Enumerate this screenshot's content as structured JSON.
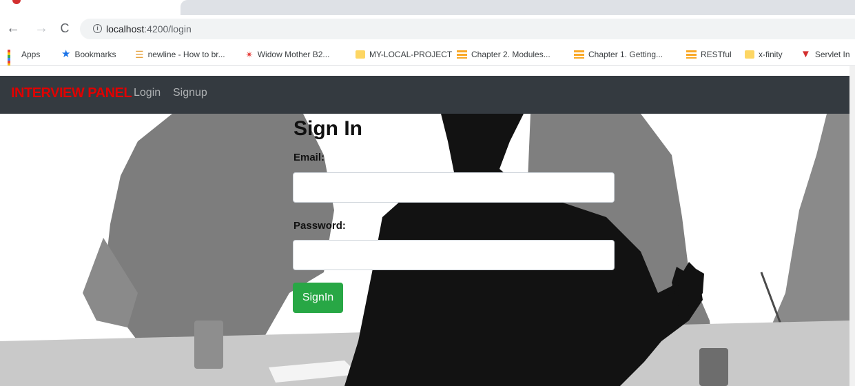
{
  "browser": {
    "url_host": "localhost",
    "url_rest": ":4200/login",
    "bookmarks": [
      {
        "label": "Apps",
        "icon": "apps-grid-icon"
      },
      {
        "label": "Bookmarks",
        "icon": "star-icon"
      },
      {
        "label": "newline - How to br...",
        "icon": "newline-icon"
      },
      {
        "label": "Widow Mother B2...",
        "icon": "widow-icon"
      },
      {
        "label": "MY-LOCAL-PROJECT",
        "icon": "folder-icon"
      },
      {
        "label": "Chapter 2. Modules...",
        "icon": "lines-icon"
      },
      {
        "label": "Chapter 1. Getting...",
        "icon": "lines-icon"
      },
      {
        "label": "RESTful",
        "icon": "lines-icon"
      },
      {
        "label": "x-finity",
        "icon": "folder-icon"
      },
      {
        "label": "Servlet In",
        "icon": "servlet-icon"
      }
    ]
  },
  "navbar": {
    "brand": "INTERVIEW PANEL",
    "links": [
      "Login",
      "Signup"
    ],
    "background": "#343a40",
    "brand_color": "#e00000"
  },
  "form": {
    "title": "Sign In",
    "email_label": "Email:",
    "email_value": "",
    "password_label": "Password:",
    "password_value": "",
    "submit_label": "SignIn",
    "submit_color": "#28a745"
  }
}
